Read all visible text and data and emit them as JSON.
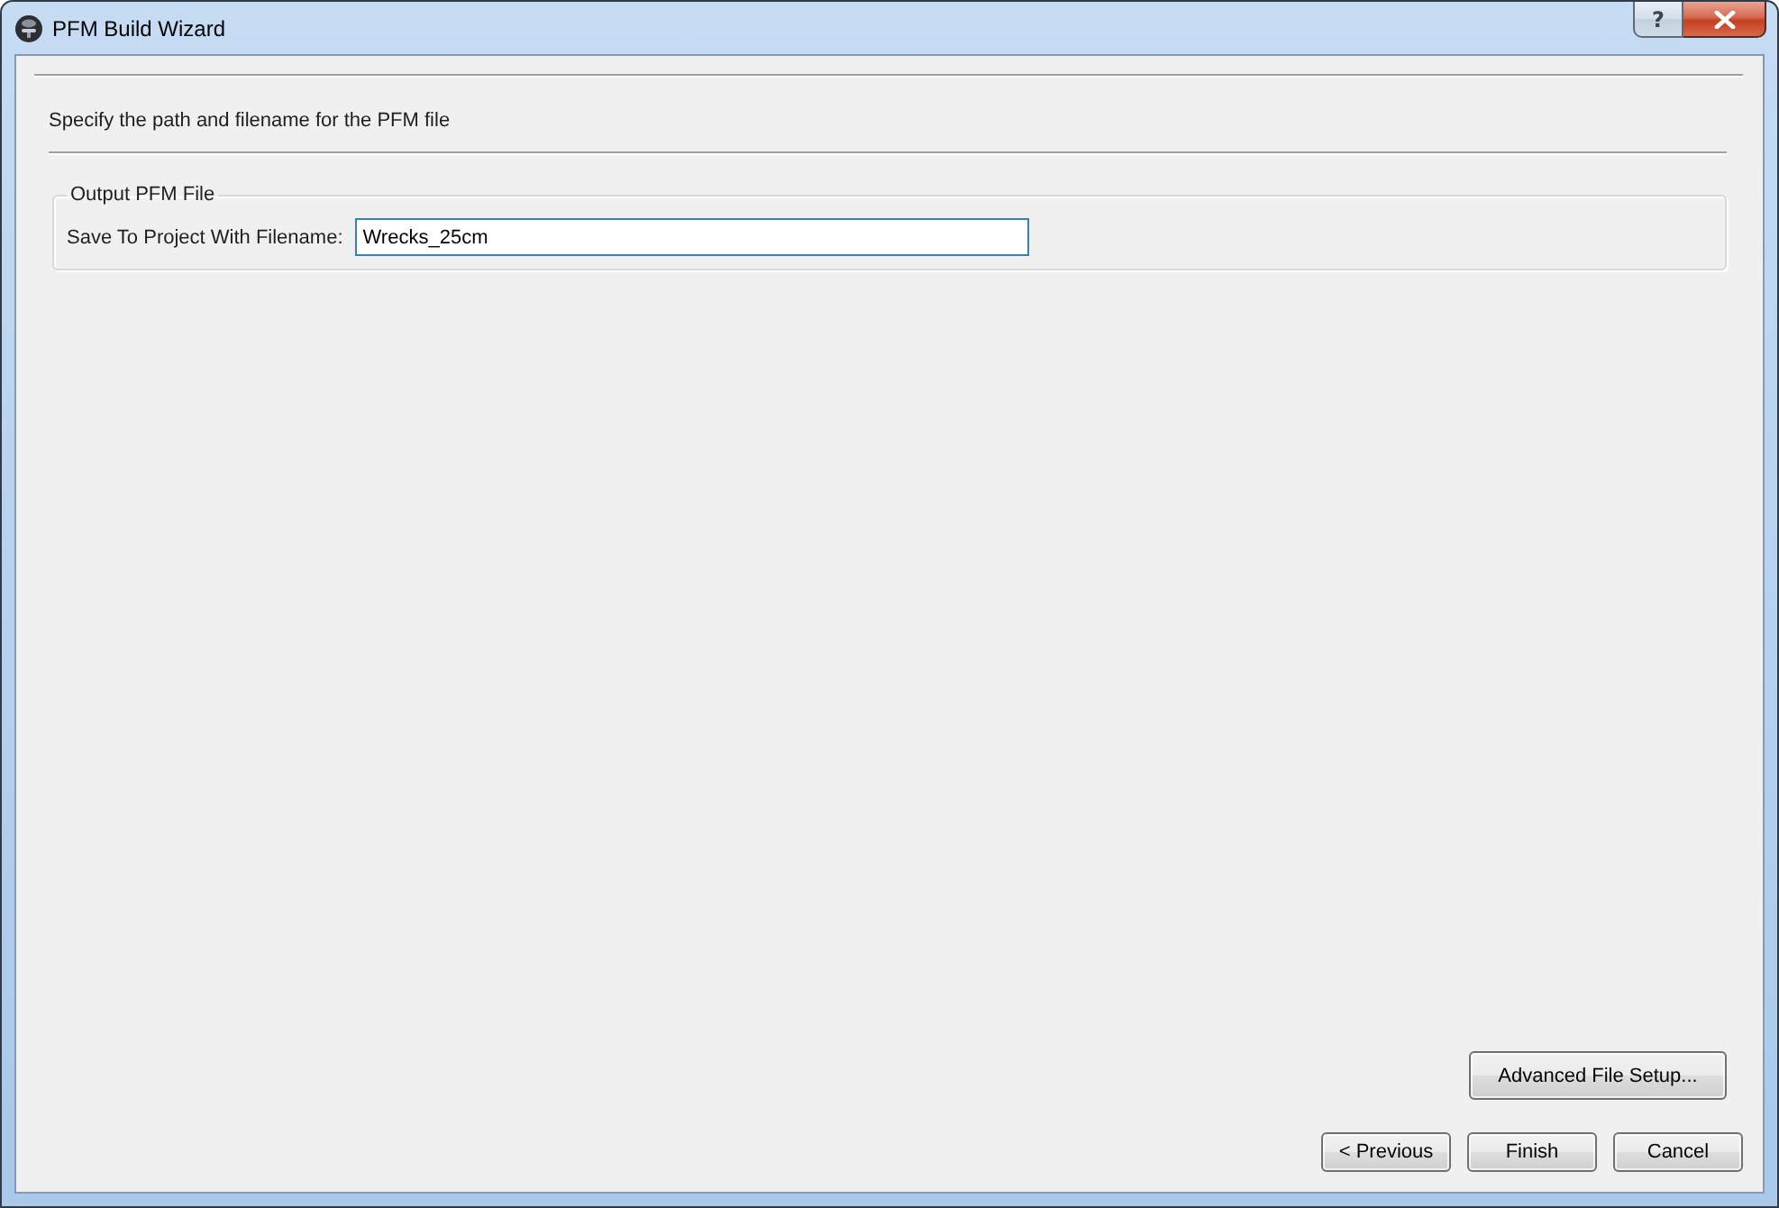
{
  "window": {
    "title": "PFM Build Wizard",
    "help_button": "?"
  },
  "page": {
    "instruction": "Specify the path and filename for the PFM file"
  },
  "output_group": {
    "title": "Output PFM File",
    "field_label": "Save To Project With Filename:",
    "filename": "Wrecks_25cm",
    "focused": true
  },
  "advanced_button": "Advanced File Setup...",
  "buttons": [
    {
      "label": "< Previous"
    },
    {
      "label": "Finish"
    },
    {
      "label": "Cancel"
    }
  ]
}
